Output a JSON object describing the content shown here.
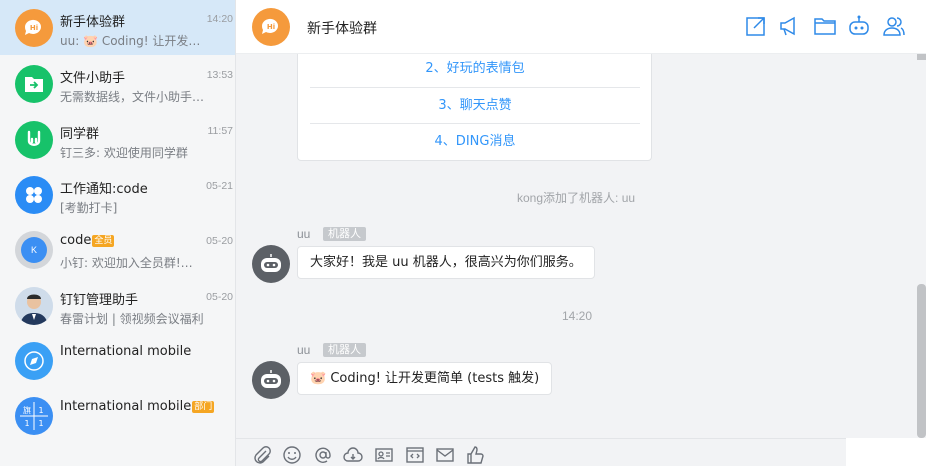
{
  "sidebar": {
    "conversations": [
      {
        "name": "新手体验群",
        "time": "14:20",
        "preview": "uu: 🐷 Coding!  让开发…",
        "avatar_text": "Hi",
        "color": "#f59a3c",
        "tag": ""
      },
      {
        "name": "文件小助手",
        "time": "13:53",
        "preview": "无需数据线，文件小助手…",
        "avatar_text": "",
        "color": "#17c26a",
        "tag": ""
      },
      {
        "name": "同学群",
        "time": "11:57",
        "preview": "钉三多: 欢迎使用同学群",
        "avatar_text": "",
        "color": "#17c26a",
        "tag": ""
      },
      {
        "name": "工作通知:code",
        "time": "05-21",
        "preview": "[考勤打卡]",
        "avatar_text": "",
        "color": "#2a8cf5",
        "tag": ""
      },
      {
        "name": "code",
        "time": "05-20",
        "preview": "小钉: 欢迎加入全员群!…",
        "avatar_text": "K",
        "color": "#3b8ff3",
        "tag": "全员"
      },
      {
        "name": "钉钉管理助手",
        "time": "05-20",
        "preview": "春雷计划 | 领视频会议福利",
        "avatar_text": "",
        "color": "#3a6ea5",
        "tag": ""
      },
      {
        "name": "International mobile",
        "time": "",
        "preview": "",
        "avatar_text": "",
        "color": "#3aa0f5",
        "tag": ""
      },
      {
        "name": "International mobile",
        "time": "",
        "preview": "",
        "avatar_text": "旗",
        "color": "#3b8ff3",
        "tag": "部门"
      }
    ]
  },
  "header": {
    "title": "新手体验群",
    "avatar_text": "Hi"
  },
  "chat": {
    "card_items": [
      "2、好玩的表情包",
      "3、聊天点赞",
      "4、DING消息"
    ],
    "system_message": "kong添加了机器人: uu",
    "messages": [
      {
        "sender": "uu",
        "badge": "机器人",
        "text": "大家好！我是 uu 机器人，很高兴为你们服务。"
      },
      {
        "sender": "uu",
        "badge": "机器人",
        "text": "🐷 Coding!  让开发更简单 (tests 触发)"
      }
    ],
    "timestamp": "14:20"
  },
  "colors": {
    "accent": "#3296fa",
    "active_row": "#d6e8f8",
    "orange": "#f59a3c",
    "green": "#17c26a"
  }
}
